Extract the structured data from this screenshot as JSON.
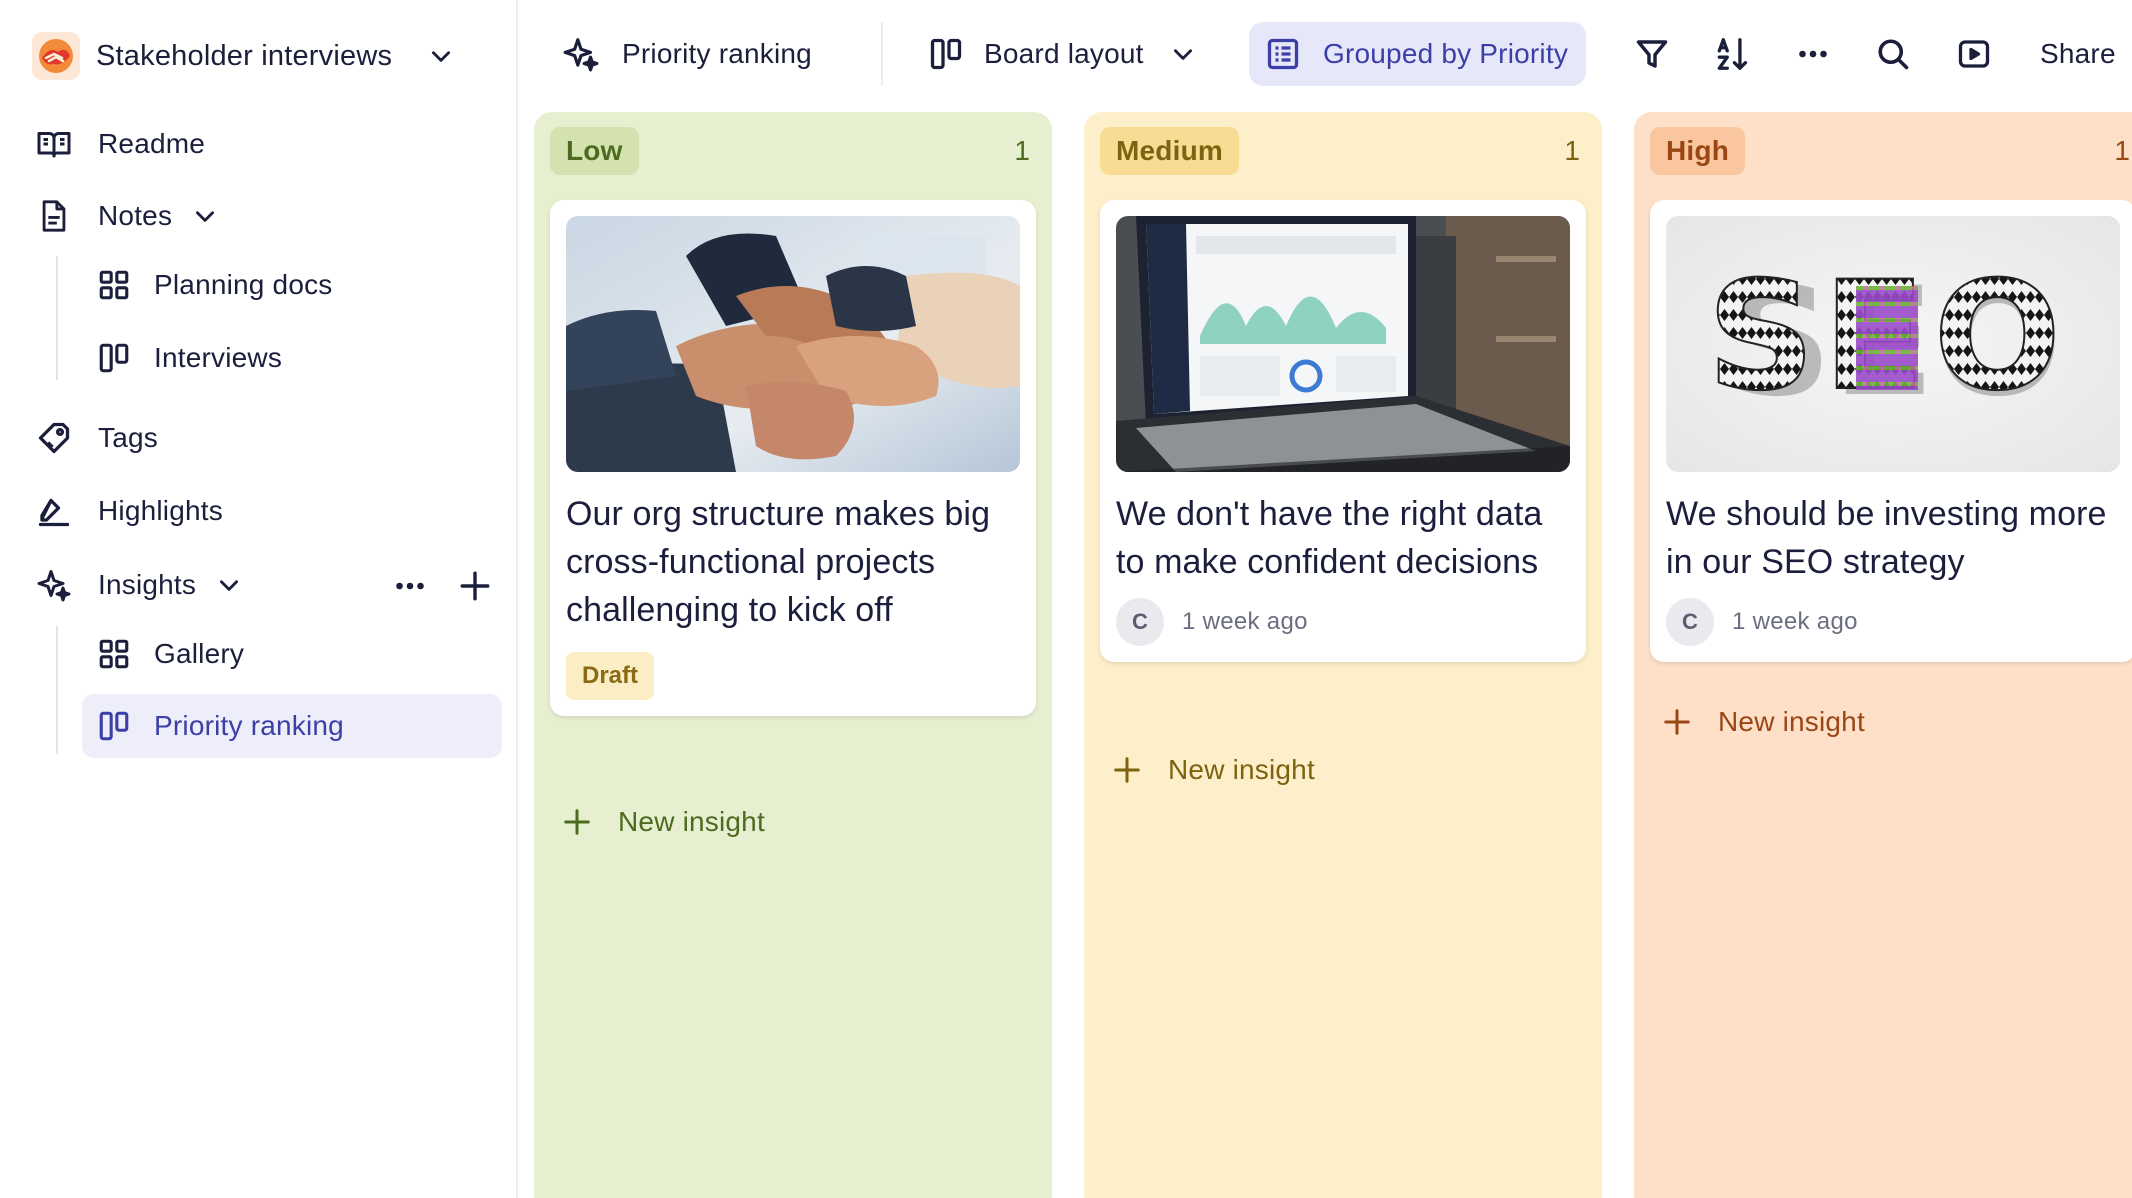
{
  "workspace": {
    "name": "Stakeholder interviews"
  },
  "sidebar": {
    "readme": "Readme",
    "notes": "Notes",
    "notes_children": [
      "Planning docs",
      "Interviews"
    ],
    "tags": "Tags",
    "highlights": "Highlights",
    "insights": "Insights",
    "insights_children": [
      "Gallery",
      "Priority ranking"
    ],
    "active_item": "Priority ranking"
  },
  "toolbar": {
    "view_title": "Priority ranking",
    "layout_label": "Board layout",
    "grouping_label": "Grouped by Priority",
    "share_label": "Share",
    "icons": [
      "filter-icon",
      "sort-icon",
      "more-icon",
      "search-icon",
      "present-icon"
    ]
  },
  "columns": [
    {
      "label": "Low",
      "count": "1",
      "colors": {
        "bg": "#e7efd1",
        "pill_bg": "#d3e2ae",
        "text": "#4d6b1f"
      },
      "cards": [
        {
          "title": "Our org structure makes big cross-functional projects challenging to kick off",
          "status": "Draft",
          "image": "hands-teamwork-photo"
        }
      ],
      "new_label": "New insight"
    },
    {
      "label": "Medium",
      "count": "1",
      "colors": {
        "bg": "#fcefc9",
        "pill_bg": "#f8dc93",
        "text": "#7d6210"
      },
      "cards": [
        {
          "title": "We don't have the right data to make confident decisions",
          "avatar": "C",
          "time": "1 week ago",
          "image": "laptop-analytics-photo"
        }
      ],
      "new_label": "New insight"
    },
    {
      "label": "High",
      "count": "1",
      "colors": {
        "bg": "#fde0c7",
        "pill_bg": "#fac6a0",
        "text": "#9a4615"
      },
      "cards": [
        {
          "title": "We should be investing more in our SEO strategy",
          "avatar": "C",
          "time": "1 week ago",
          "image": "seo-letters-photo",
          "image_text": "SEO"
        }
      ],
      "new_label": "New insight"
    }
  ]
}
